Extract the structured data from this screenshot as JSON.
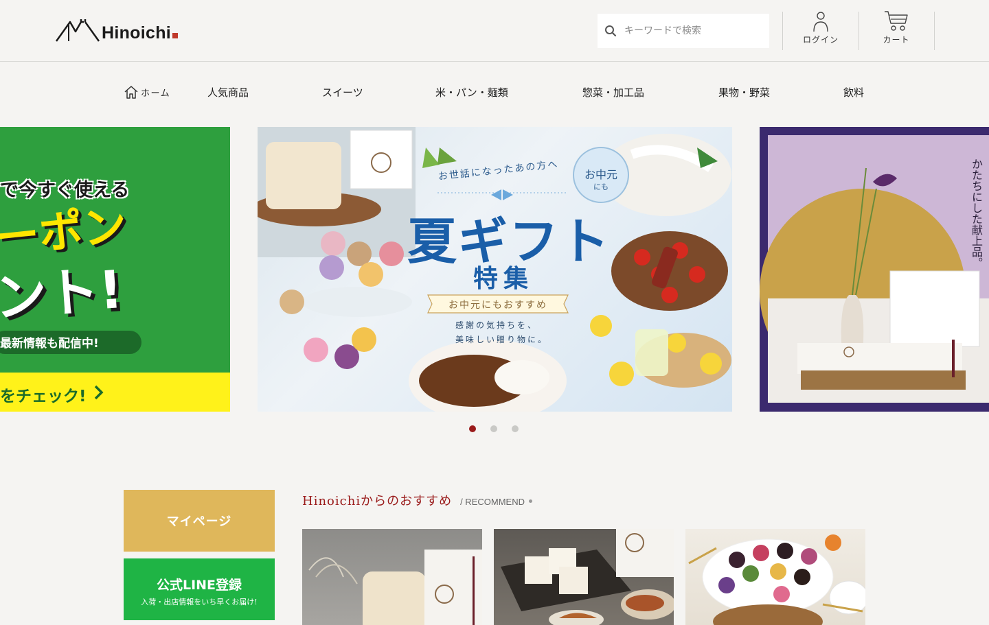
{
  "header": {
    "logo_text": "Hinoichi",
    "search_placeholder": "キーワードで検索",
    "login_label": "ログイン",
    "cart_label": "カート"
  },
  "nav": {
    "items": [
      {
        "label": "ホーム",
        "icon": "home-icon"
      },
      {
        "label": "人気商品"
      },
      {
        "label": "スイーツ"
      },
      {
        "label": "米・パン・麺類"
      },
      {
        "label": "惣菜・加工品"
      },
      {
        "label": "果物・野菜"
      },
      {
        "label": "飲料"
      }
    ]
  },
  "carousel": {
    "left": {
      "line1": "で今すぐ使える",
      "line2": "ーポン",
      "line3": "ント!",
      "line4": "最新情報も配信中!",
      "line5": "をチェック!"
    },
    "center": {
      "top_text": "お世話になったあの方へ",
      "badge_line1": "お中元",
      "badge_line2": "にも",
      "title": "夏ギフト",
      "subtitle": "特集",
      "ribbon": "お中元にもおすすめ",
      "caption1": "感謝の気持ちを、",
      "caption2": "美味しい贈り物に。"
    },
    "right": {
      "vertical_text": "かたちにした献上品。"
    },
    "active_index": 0,
    "slide_count": 3
  },
  "sidebar": {
    "mypage_label": "マイページ",
    "line_title": "公式LINE登録",
    "line_sub": "入荷・出店情報をいち早くお届け!"
  },
  "recommend": {
    "title": "Hinoichiからのおすすめ",
    "subtitle": "/ RECOMMEND"
  },
  "colors": {
    "accent": "#9a1b1b",
    "mypage": "#dfb75b",
    "line_green": "#1fb445",
    "coupon_green": "#2e9f3e",
    "coupon_yellow": "#fff21a"
  }
}
